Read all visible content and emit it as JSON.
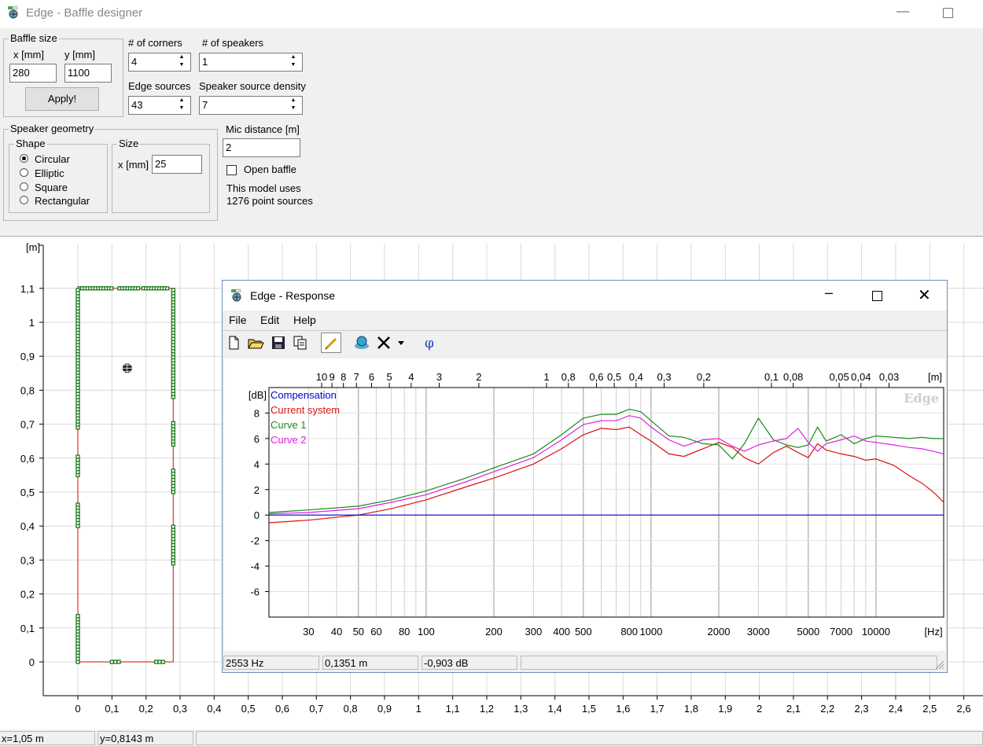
{
  "window": {
    "title": "Edge - Baffle designer"
  },
  "controls": {
    "baffle_size": {
      "caption": "Baffle size",
      "x_label": "x [mm]",
      "y_label": "y [mm]",
      "x_value": "280",
      "y_value": "1100",
      "apply_label": "Apply!"
    },
    "corners": {
      "label": "# of corners",
      "value": "4"
    },
    "speakers": {
      "label": "# of speakers",
      "value": "1"
    },
    "edge_sources": {
      "label": "Edge sources",
      "value": "43"
    },
    "speaker_density": {
      "label": "Speaker source density",
      "value": "7"
    },
    "speaker_geometry": {
      "caption": "Speaker geometry"
    },
    "shape": {
      "caption": "Shape",
      "options": [
        "Circular",
        "Elliptic",
        "Square",
        "Rectangular"
      ],
      "selected": "Circular"
    },
    "size": {
      "caption": "Size",
      "x_label": "x [mm]",
      "x_value": "25"
    },
    "mic_distance": {
      "label": "Mic distance [m]",
      "value": "2"
    },
    "open_baffle": {
      "label": "Open baffle",
      "checked": false
    },
    "model_info": {
      "line1": "This model uses",
      "line2": "1276 point sources"
    }
  },
  "baffle_plot": {
    "y_unit": "[m]",
    "y_ticks": [
      "1,1",
      "1",
      "0,9",
      "0,8",
      "0,7",
      "0,6",
      "0,5",
      "0,4",
      "0,3",
      "0,2",
      "0,1",
      "0"
    ],
    "x_ticks": [
      "0",
      "0,1",
      "0,2",
      "0,3",
      "0,4",
      "0,5",
      "0,6",
      "0,7",
      "0,8",
      "0,9",
      "1",
      "1,1",
      "1,2",
      "1,3",
      "1,4",
      "1,5",
      "1,6",
      "1,7",
      "1,8",
      "1,9",
      "2",
      "2,1",
      "2,2",
      "2,3",
      "2,4",
      "2,5",
      "2,6"
    ],
    "baffle_color": "#e03030",
    "source_color": "#1a7a1a",
    "speaker_position": [
      0.145,
      0.865
    ]
  },
  "response": {
    "title": "Edge - Response",
    "menu": [
      "File",
      "Edit",
      "Help"
    ],
    "toolbar_icons": [
      "new-icon",
      "open-icon",
      "save-icon",
      "copy-icon",
      "pen-icon",
      "speaker-icon",
      "delete-icon",
      "dropdown-arrow-icon",
      "phase-icon"
    ],
    "watermark": "Edge",
    "status": {
      "freq": "2553 Hz",
      "dist": "0,1351 m",
      "level": "-0,903 dB"
    }
  },
  "chart_data": {
    "type": "line",
    "title": "",
    "xlabel": "[Hz]",
    "ylabel": "[dB]",
    "x_scale": "log",
    "xlim": [
      20,
      20000
    ],
    "ylim": [
      -8,
      10
    ],
    "x_ticks": [
      30,
      40,
      50,
      60,
      80,
      100,
      200,
      300,
      400,
      500,
      800,
      1000,
      2000,
      3000,
      5000,
      7000,
      10000
    ],
    "x_tick_labels": [
      "30",
      "40",
      "50",
      "60",
      "80",
      "100",
      "200",
      "300",
      "400",
      "500",
      "800",
      "1000",
      "2000",
      "3000",
      "5000",
      "7000",
      "10000"
    ],
    "y_ticks": [
      8,
      6,
      4,
      2,
      0,
      -2,
      -4,
      -6
    ],
    "top_axis_label": "[m]",
    "top_axis_ticks": [
      "10",
      "9",
      "8",
      "7",
      "6",
      "5",
      "4",
      "3",
      "2",
      "1",
      "0,8",
      "0,6",
      "0,5",
      "0,4",
      "0,3",
      "0,2",
      "0,1",
      "0,08",
      "0,05",
      "0,04",
      "0,03"
    ],
    "grid": true,
    "legend_position": "top-left",
    "series": [
      {
        "name": "Compensation",
        "color": "#0000cc",
        "x": [
          20,
          20000
        ],
        "y": [
          0,
          0
        ]
      },
      {
        "name": "Current system",
        "color": "#dd1111",
        "x": [
          20,
          30,
          50,
          70,
          100,
          150,
          200,
          300,
          400,
          500,
          600,
          700,
          800,
          900,
          1000,
          1200,
          1400,
          1700,
          2000,
          2300,
          2600,
          3000,
          3500,
          4000,
          4500,
          5000,
          5500,
          6000,
          7000,
          8000,
          9000,
          10000,
          12000,
          14000,
          16000,
          18000,
          20000
        ],
        "y": [
          -0.6,
          -0.4,
          0,
          0.5,
          1.2,
          2.2,
          2.9,
          4.0,
          5.2,
          6.3,
          6.8,
          6.7,
          6.9,
          6.3,
          5.8,
          4.8,
          4.6,
          5.2,
          5.7,
          5.3,
          4.5,
          4.0,
          4.9,
          5.4,
          4.9,
          4.5,
          5.6,
          5.1,
          4.8,
          4.6,
          4.3,
          4.4,
          3.9,
          3.1,
          2.5,
          1.8,
          1.0
        ]
      },
      {
        "name": "Curve 1",
        "color": "#1a8a1a",
        "x": [
          20,
          30,
          50,
          70,
          100,
          150,
          200,
          300,
          400,
          500,
          600,
          700,
          800,
          900,
          1000,
          1200,
          1400,
          1700,
          2000,
          2300,
          2600,
          3000,
          3500,
          4000,
          4500,
          5000,
          5500,
          6000,
          7000,
          8000,
          9000,
          10000,
          12000,
          14000,
          16000,
          18000,
          20000
        ],
        "y": [
          0.2,
          0.4,
          0.7,
          1.2,
          1.9,
          2.9,
          3.7,
          4.8,
          6.3,
          7.6,
          7.9,
          7.9,
          8.3,
          8.1,
          7.4,
          6.2,
          6.1,
          5.6,
          5.5,
          4.4,
          5.6,
          7.6,
          5.9,
          5.5,
          5.3,
          5.5,
          6.9,
          5.8,
          6.3,
          5.6,
          6.0,
          6.2,
          6.1,
          6.0,
          6.1,
          6.0,
          6.0
        ]
      },
      {
        "name": "Curve 2",
        "color": "#dd22dd",
        "x": [
          20,
          30,
          50,
          70,
          100,
          150,
          200,
          300,
          400,
          500,
          600,
          700,
          800,
          900,
          1000,
          1200,
          1400,
          1700,
          2000,
          2300,
          2600,
          3000,
          3500,
          4000,
          4500,
          5000,
          5500,
          6000,
          7000,
          8000,
          9000,
          10000,
          12000,
          14000,
          16000,
          18000,
          20000
        ],
        "y": [
          0.1,
          0.2,
          0.5,
          1.0,
          1.6,
          2.6,
          3.4,
          4.5,
          5.9,
          7.1,
          7.4,
          7.4,
          7.8,
          7.6,
          6.9,
          5.9,
          5.4,
          5.9,
          6.0,
          5.4,
          5.0,
          5.5,
          5.8,
          6.0,
          6.8,
          5.7,
          5.0,
          5.6,
          5.9,
          6.2,
          5.8,
          5.7,
          5.5,
          5.3,
          5.2,
          5.0,
          4.8
        ]
      }
    ]
  },
  "statusbar": {
    "x": "x=1,05 m",
    "y": "y=0,8143 m"
  }
}
